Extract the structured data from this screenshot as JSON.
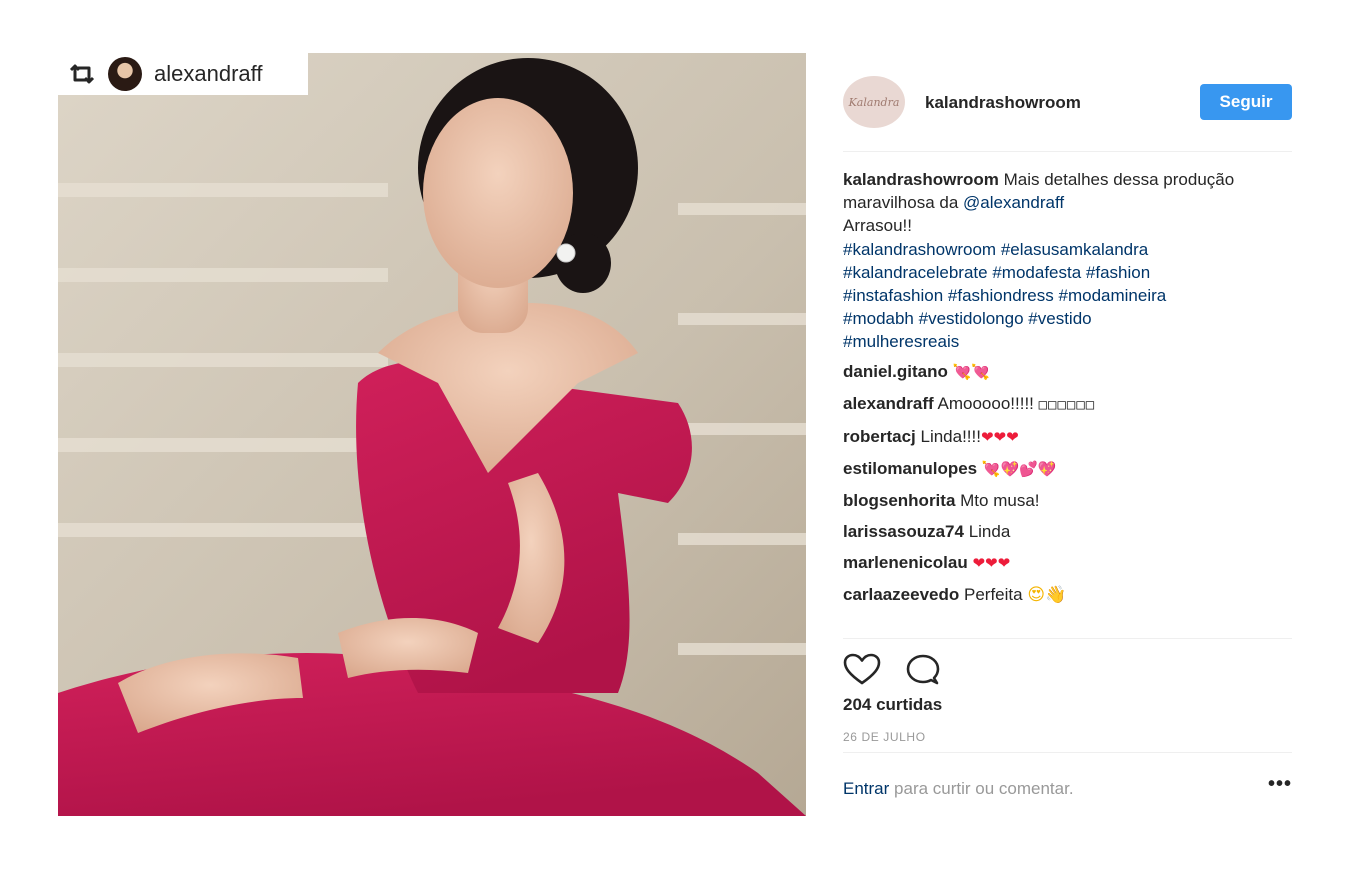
{
  "photo": {
    "repost_username": "alexandraff",
    "repost_icon": "repost-icon"
  },
  "header": {
    "username": "kalandrashowroom",
    "avatar_text": "Kalandra",
    "follow_label": "Seguir"
  },
  "caption": {
    "username": "kalandrashowroom",
    "text_before_mention": "Mais detalhes dessa produção maravilhosa da",
    "mention": "@alexandraff",
    "text_after_mention": "Arrasou!!",
    "hashtags": [
      "#kalandrashowroom",
      "#elasusamkalandra",
      "#kalandracelebrate",
      "#modafesta",
      "#fashion",
      "#instafashion",
      "#fashiondress",
      "#modamineira",
      "#modabh",
      "#vestidolongo",
      "#vestido",
      "#mulheresreais"
    ]
  },
  "comments": [
    {
      "username": "daniel.gitano",
      "text": "",
      "emoji": "💘💘"
    },
    {
      "username": "alexandraff",
      "text": "Amooooo!!!!!",
      "emoji": "□□□□□□"
    },
    {
      "username": "robertacj",
      "text": "Linda!!!!",
      "emoji": "❤❤❤"
    },
    {
      "username": "estilomanulopes",
      "text": "",
      "emoji": "💘💖💕💖"
    },
    {
      "username": "blogsenhorita",
      "text": "Mto musa!",
      "emoji": ""
    },
    {
      "username": "larissasouza74",
      "text": "Linda",
      "emoji": ""
    },
    {
      "username": "marlenenicolau",
      "text": "",
      "emoji": "❤❤❤"
    },
    {
      "username": "carlaazeevedo",
      "text": "Perfeita",
      "emoji": "😍👋"
    }
  ],
  "actions": {
    "like_icon": "heart-icon",
    "comment_icon": "comment-icon",
    "likes": "204 curtidas",
    "date": "26 DE JULHO"
  },
  "footer": {
    "login_link": "Entrar",
    "login_text": "para curtir ou comentar.",
    "more_label": "•••"
  },
  "colors": {
    "accent": "#3897f0",
    "link": "#003569",
    "muted": "#999999",
    "text": "#262626",
    "dress": "#c8174f"
  }
}
